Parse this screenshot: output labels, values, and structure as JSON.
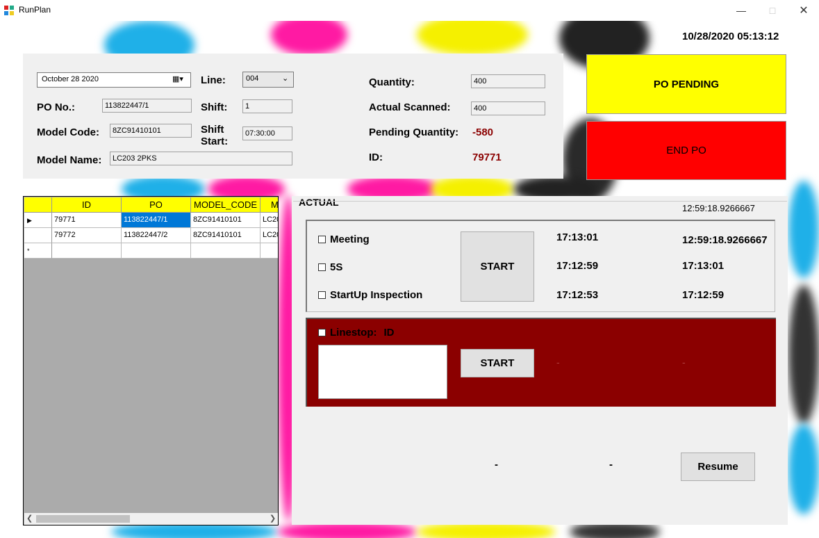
{
  "window": {
    "title": "RunPlan"
  },
  "clock": "10/28/2020 05:13:12",
  "info": {
    "date_value": "October   28 2020",
    "line_label": "Line:",
    "line_value": "004",
    "po_label": "PO No.:",
    "po_value": "113822447/1",
    "shift_label": "Shift:",
    "shift_value": "1",
    "model_code_label": "Model Code:",
    "model_code_value": "8ZC91410101",
    "shift_start_label_1": "Shift",
    "shift_start_label_2": "Start:",
    "shift_start_value": "07:30:00",
    "model_name_label": "Model Name:",
    "model_name_value": "LC203 2PKS",
    "quantity_label": "Quantity:",
    "quantity_value": "400",
    "actual_scanned_label": "Actual Scanned:",
    "actual_scanned_value": "400",
    "pending_qty_label": "Pending Quantity:",
    "pending_qty_value": "-580",
    "id_label": "ID:",
    "id_value": "79771"
  },
  "status_buttons": {
    "po_pending": "PO PENDING",
    "end_po": "END PO",
    "po_pending_color": "#ffff00",
    "end_po_color": "#ff0000"
  },
  "grid": {
    "columns": [
      "ID",
      "PO",
      "MODEL_CODE",
      "M"
    ],
    "rows": [
      {
        "marker": "▶",
        "cells": [
          "79771",
          "113822447/1",
          "8ZC91410101",
          "LC20"
        ]
      },
      {
        "marker": "",
        "cells": [
          "79772",
          "113822447/2",
          "8ZC91410101",
          "LC20"
        ]
      }
    ],
    "new_row_marker": "*",
    "header_color": "#ffff00"
  },
  "actual": {
    "title": "ACTUAL",
    "top_time": "12:59:18.9266667",
    "activities": [
      {
        "label": "Meeting",
        "start": "17:13:01",
        "end": "12:59:18.9266667"
      },
      {
        "label": "5S",
        "start": "17:12:59",
        "end": "17:13:01"
      },
      {
        "label": "StartUp Inspection",
        "start": "17:12:53",
        "end": "17:12:59"
      }
    ],
    "start_button": "START",
    "linestop": {
      "label": "Linestop:",
      "id_label": "ID",
      "start_button": "START",
      "start_dash": "-",
      "end_dash": "-",
      "color": "#8b0000"
    },
    "bottom_dash_1": "-",
    "bottom_dash_2": "-",
    "resume_button": "Resume"
  }
}
